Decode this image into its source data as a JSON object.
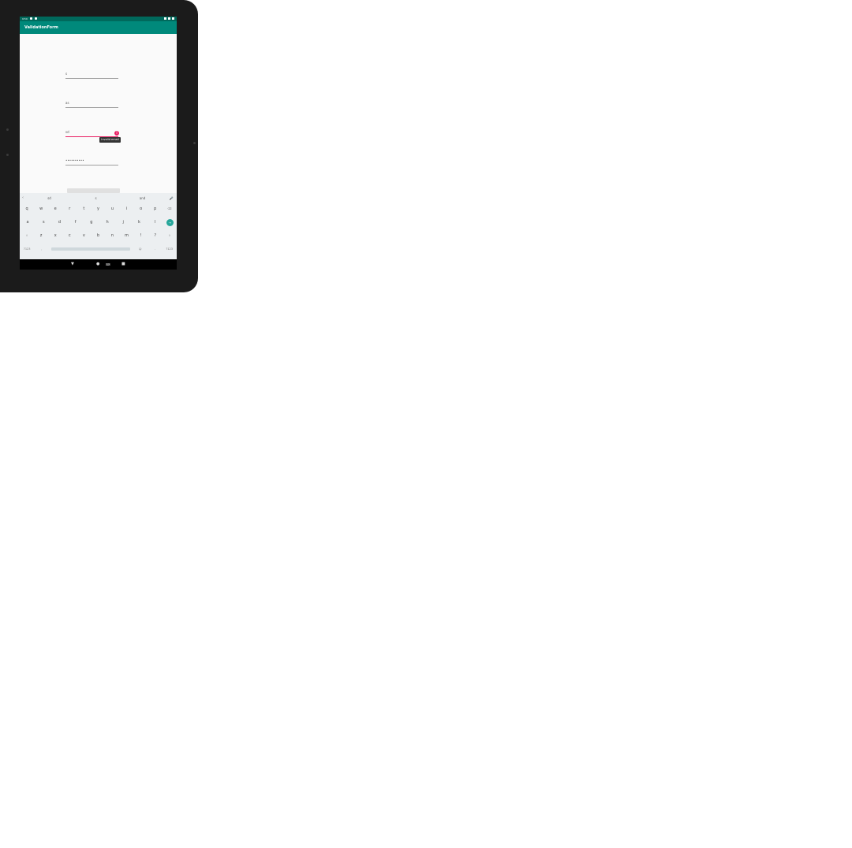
{
  "status_bar": {
    "time": "9:59"
  },
  "app_bar": {
    "title": "ValidationForm"
  },
  "form": {
    "fields": [
      {
        "value": "s"
      },
      {
        "value": "as"
      },
      {
        "value": "sd"
      },
      {
        "value": "••••••••••"
      }
    ],
    "error_message": "Invalid email"
  },
  "keyboard": {
    "suggestions": [
      "sd",
      "s",
      "and"
    ],
    "row1": [
      "q",
      "w",
      "e",
      "r",
      "t",
      "y",
      "u",
      "i",
      "o",
      "p",
      "⌫"
    ],
    "row2": [
      "a",
      "s",
      "d",
      "f",
      "g",
      "h",
      "j",
      "k",
      "l"
    ],
    "row3": [
      "⇧",
      "z",
      "x",
      "c",
      "v",
      "b",
      "n",
      "m",
      "!",
      "?",
      "⇧"
    ],
    "row4": {
      "left": "?123",
      "comma": ",",
      "emoji": "☺",
      "period": ".",
      "right": "?123"
    }
  },
  "colors": {
    "primary": "#00897b",
    "primary_dark": "#00695c",
    "error": "#e91e63",
    "accent": "#26a69a"
  },
  "icons": {
    "back": "back-triangle-icon",
    "home": "home-circle-icon",
    "recents": "recents-square-icon"
  }
}
